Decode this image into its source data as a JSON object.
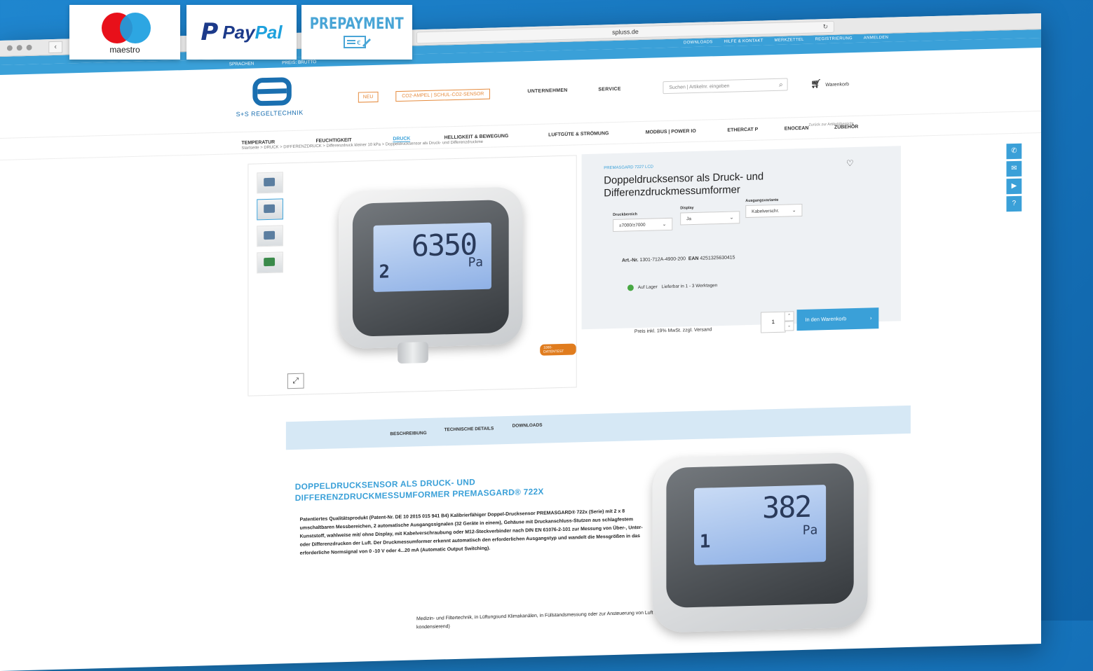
{
  "badges": {
    "maestro": "maestro",
    "paypal_a": "Pay",
    "paypal_b": "Pal",
    "prepayment": "PREPAYMENT"
  },
  "browser": {
    "url": "spluss.de"
  },
  "topbar": [
    "DOWNLOADS",
    "HILFE & KONTAKT",
    "MERKZETTEL",
    "REGISTRIERUNG",
    "ANMELDEN"
  ],
  "langbar": {
    "language": "SPRACHEN",
    "prices": "PREIS: BRUTTO"
  },
  "header": {
    "logo_text": "S+S REGELTECHNIK",
    "new_label": "NEU",
    "co2_label": "CO2-AMPEL | SCHUL-CO2-SENSOR",
    "company": "UNTERNEHMEN",
    "service": "SERVICE",
    "search_placeholder": "Suchen | Artikelnr. eingeben",
    "cart": "Warenkorb"
  },
  "catnav": {
    "temperatur": "TEMPERATUR",
    "feuchtigkeit": "FEUCHTIGKEIT",
    "druck": "DRUCK",
    "helligkeit": "HELLIGKEIT & BEWEGUNG",
    "luftguete": "LUFTGÜTE & STRÖMUNG",
    "modbus": "MODBUS | POWER IO",
    "ethercat": "ETHERCAT P",
    "enocean": "ENOCEAN",
    "zubehoer": "ZUBEHÖR"
  },
  "breadcrumb": "Startseite > DRUCK > DIFFERENZDRUCK > Differenzdruck kleiner 10 kPa > Doppeldrucksensor als Druck- und Differenzdruckme",
  "backlink": "Zurück zur Artikelübersicht",
  "gallery": {
    "lcd_value": "6350",
    "lcd_unit": "Pa",
    "lcd_channel": "2",
    "badge": "1000-DATENTEST"
  },
  "product": {
    "series": "PREMASGARD 7227 LCD",
    "title": "Doppeldrucksensor als Druck- und Differenzdruckmessumformer",
    "range_label": "Druckbereich",
    "range_value": "±7000/±7000",
    "display_label": "Display",
    "display_value": "Ja",
    "output_label": "Ausgangsvariante",
    "output_value": "Kabelverschr.",
    "art_label": "Art.-Nr.",
    "art_value": "1301-712A-4900-200",
    "ean_label": "EAN",
    "ean_value": "4251325630415",
    "stock_label": "Auf Lager",
    "stock_text": "Lieferbar in 1 - 3 Werktagen",
    "qty": "1",
    "add_to_cart": "In den Warenkorb",
    "price_note": "Preis inkl. 19% MwSt. zzgl. Versand"
  },
  "tabs": {
    "desc": "BESCHREIBUNG",
    "tech": "TECHNISCHE DETAILS",
    "downloads": "DOWNLOADS"
  },
  "description": {
    "title": "DOPPELDRUCKSENSOR ALS DRUCK- UND DIFFERENZDRUCKMESSUMFORMER PREMASGARD® 722X",
    "text": "Patentiertes Qualitätsprodukt (Patent-Nr. DE 10 2015 015 941 B4) Kalibrierfähiger Doppel-Drucksensor PREMASGARD® 722x (Serie) mit 2 x 8 umschaltbaren Messbereichen, 2 automatische Ausgangssignalen (32 Geräte in einem), Gehäuse mit Druckanschluss-Stutzen aus schlagfestem Kunststoff, wahlweise mit/ ohne Display, mit Kabelverschraubung oder M12-Steckverbinder nach DIN EN 61076-2-101 zur Messung von Über-, Unter- oder Differenzdrucken der Luft. Der Druckmessumformer erkennt automatisch den erforderlichen Ausgangstyp und wandelt die Messgrößen in das erforderliche Normsignal von 0 -10 V oder 4...20 mA (Automatic Output Switching).",
    "text2": "Medizin- und Filtertechnik, in Lüftungsund Klimakanälen, in Füllstandsmessung oder zur Ansteuerung von Luft (nicht kondensierend)"
  },
  "device2": {
    "lcd_value": "382",
    "lcd_unit": "Pa",
    "lcd_channel": "1"
  }
}
